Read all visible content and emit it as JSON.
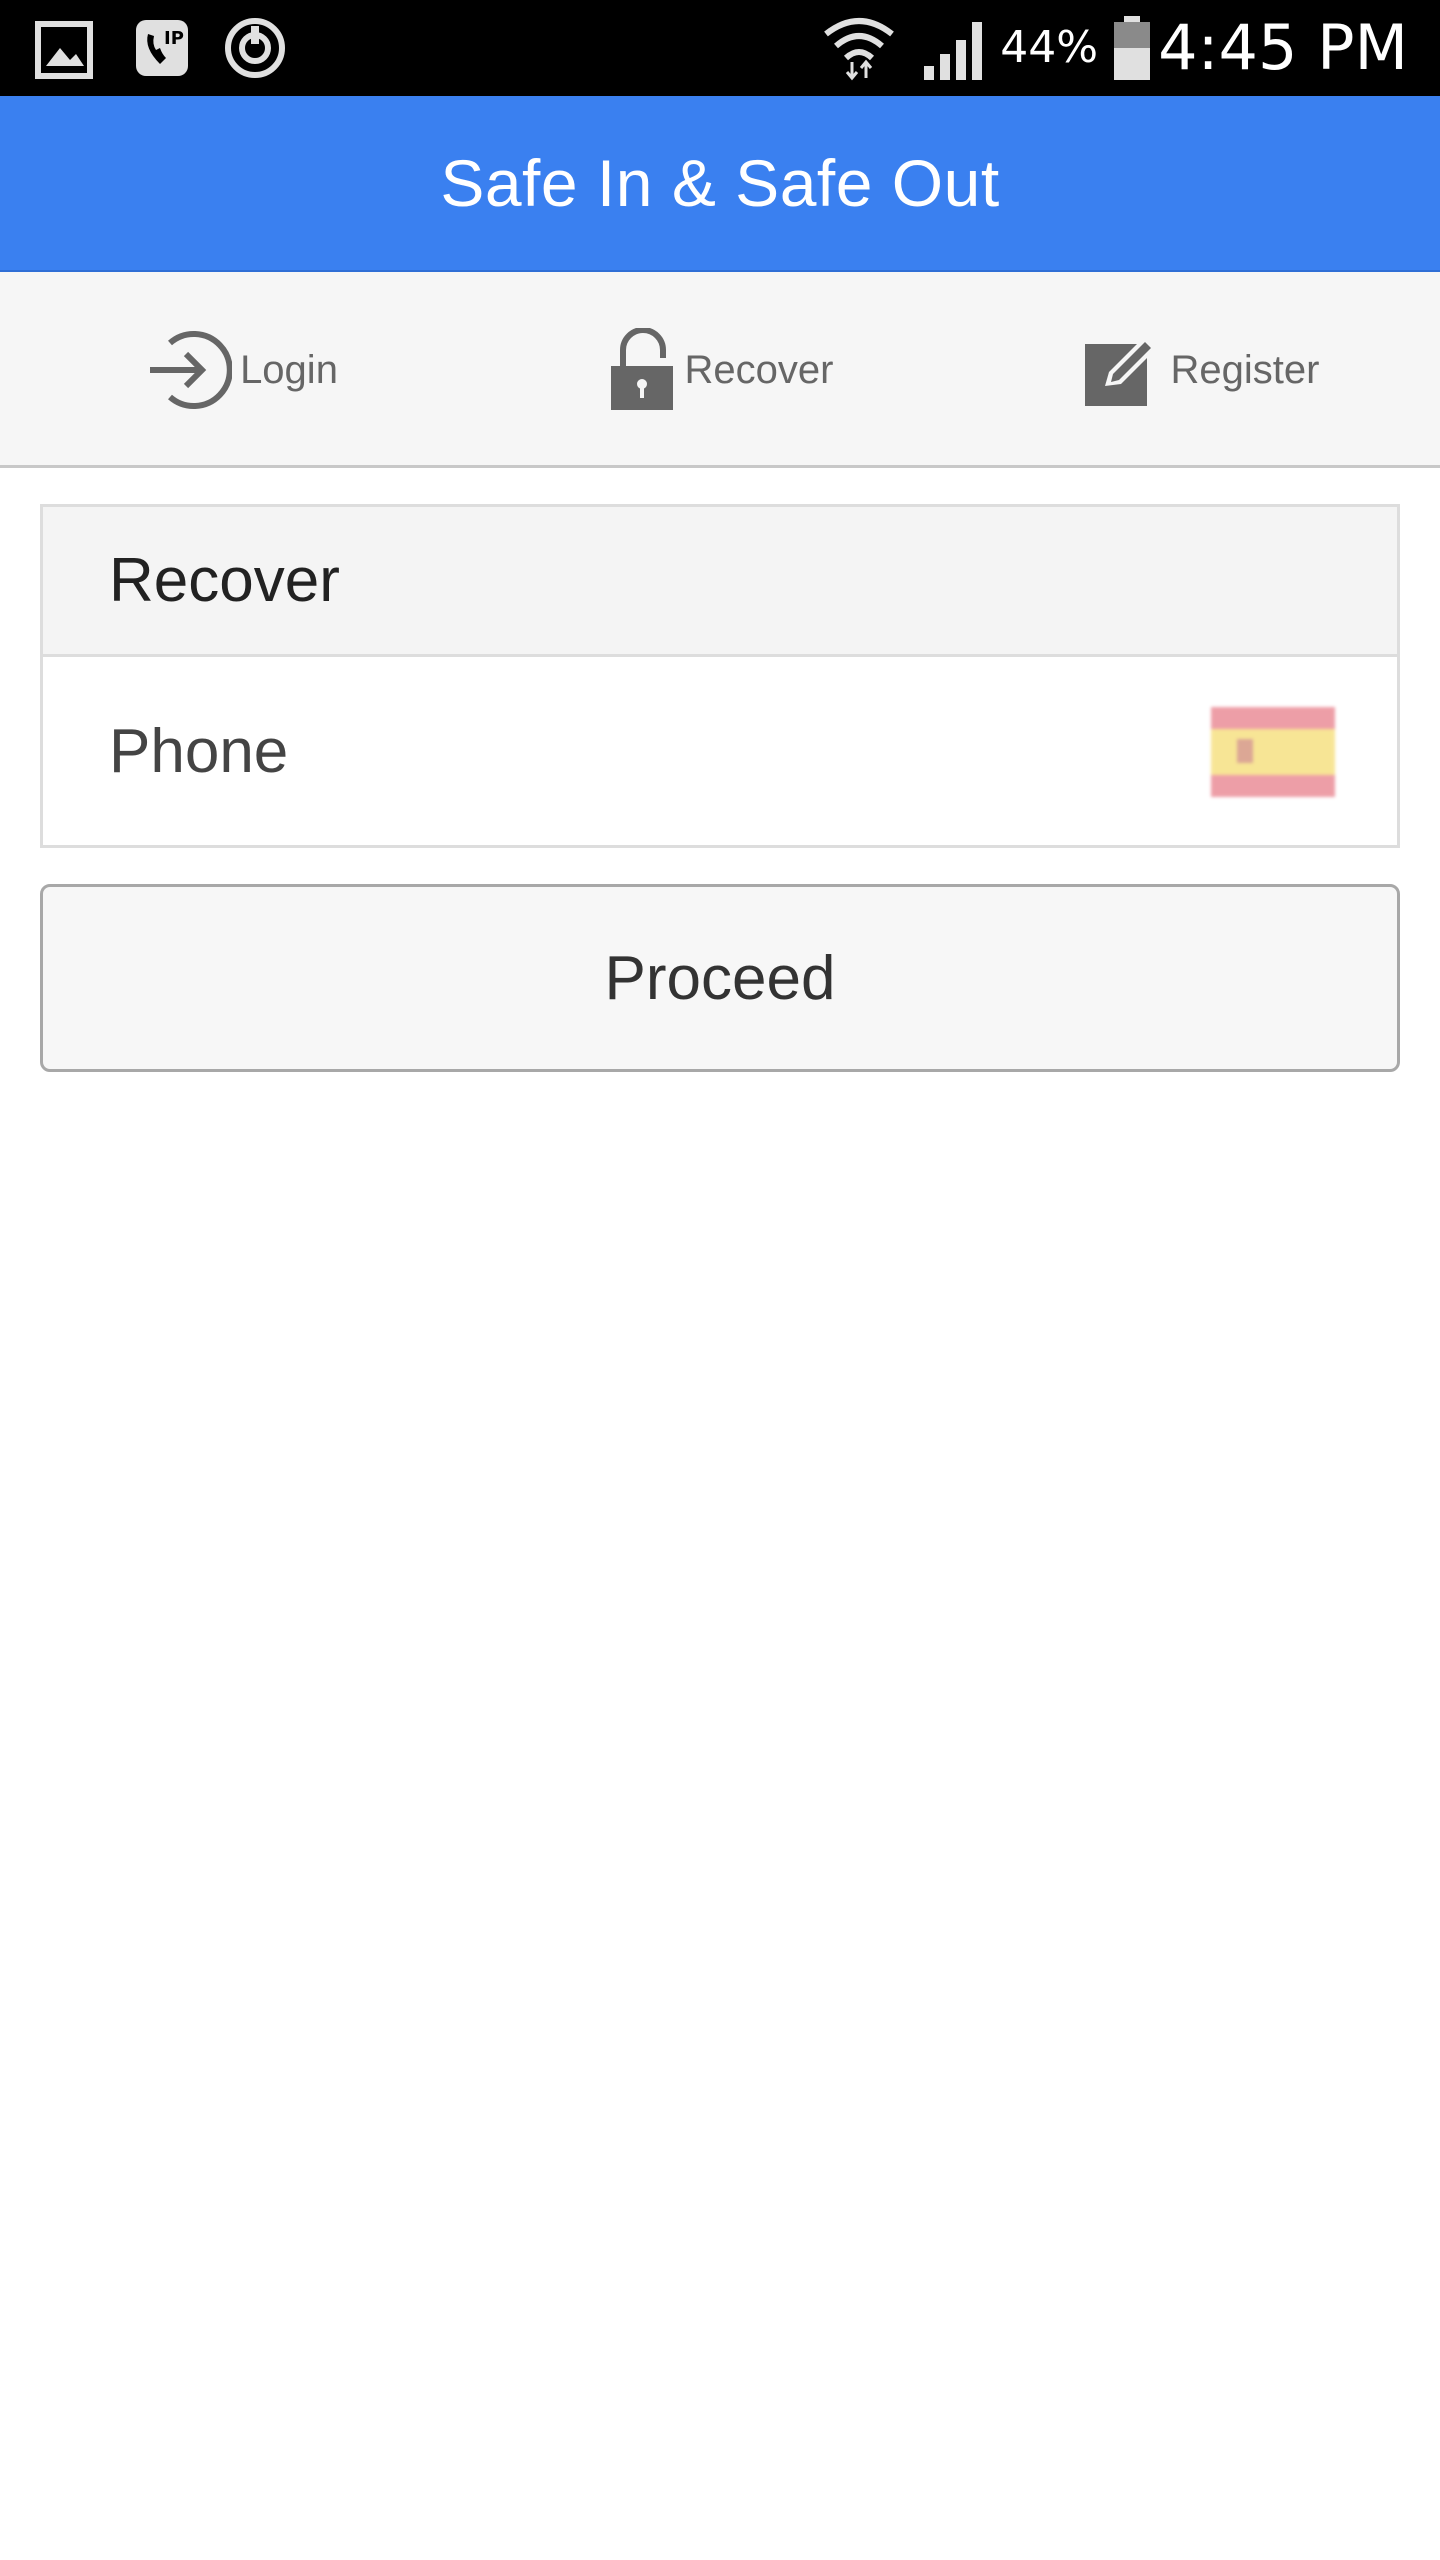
{
  "status_bar": {
    "battery_percent": "44%",
    "time": "4:45 PM",
    "left_icons": [
      "gallery-icon",
      "voip-call-icon",
      "sync-power-icon"
    ],
    "right_icons": [
      "wifi-icon",
      "cell-signal-icon",
      "battery-icon"
    ]
  },
  "header": {
    "title": "Safe In & Safe Out",
    "color": "#3a80f0"
  },
  "tabs": [
    {
      "label": "Login",
      "icon": "login-arrow-icon"
    },
    {
      "label": "Recover",
      "icon": "unlock-icon"
    },
    {
      "label": "Register",
      "icon": "edit-icon"
    }
  ],
  "recover_panel": {
    "title": "Recover",
    "phone_placeholder": "Phone",
    "country_flag": "spain-flag-icon"
  },
  "proceed_button": {
    "label": "Proceed"
  }
}
